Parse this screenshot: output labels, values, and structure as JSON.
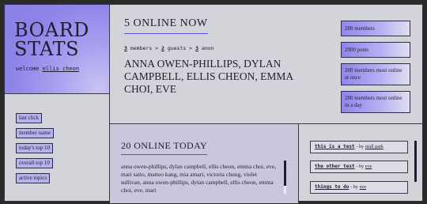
{
  "brand": {
    "title_line1": "BOARD",
    "title_line2": "STATS",
    "welcome_label": "welcome",
    "username": "ellis cheon"
  },
  "online_now": {
    "title": "5 ONLINE NOW",
    "members_count": "3",
    "members_label": "members",
    "guests_count": "2",
    "guests_label": "guests",
    "anon_count": "3",
    "anon_label": "anon",
    "separator": ">",
    "names": "ANNA OWEN-PHILLIPS, DYLAN CAMPBELL, ELLIS CHEON, EMMA CHOI, EVE"
  },
  "stats": [
    {
      "label": "200 members"
    },
    {
      "label": "2000 posts"
    },
    {
      "label": "200 members most online at once"
    },
    {
      "label": "200 members most online in a day"
    }
  ],
  "nav": [
    {
      "label": "last click"
    },
    {
      "label": "member name"
    },
    {
      "label": "today's top 10"
    },
    {
      "label": "overall top 10"
    },
    {
      "label": "active topics"
    }
  ],
  "online_today": {
    "title": "20 ONLINE TODAY",
    "names": "anna owen-phillips, dylan campbell, ellis cheon, emma choi, eve, mari saito, matteo kang, mia amari, victoria chung, violet sullivan, anna owen-phillips, dylan campbell, ellis cheon, emma choi, eve, mari"
  },
  "threads": [
    {
      "title": "this is a test",
      "by": "- by",
      "author": "niall park"
    },
    {
      "title": "the other test",
      "by": "- by",
      "author": "eve"
    },
    {
      "title": "things to do",
      "by": "- by",
      "author": "eve"
    }
  ],
  "colors": {
    "accent": "#5a4ee0",
    "brand_gradient_start": "#8a80e6",
    "panel": "#d3d3da",
    "text": "#1f1d2e"
  }
}
